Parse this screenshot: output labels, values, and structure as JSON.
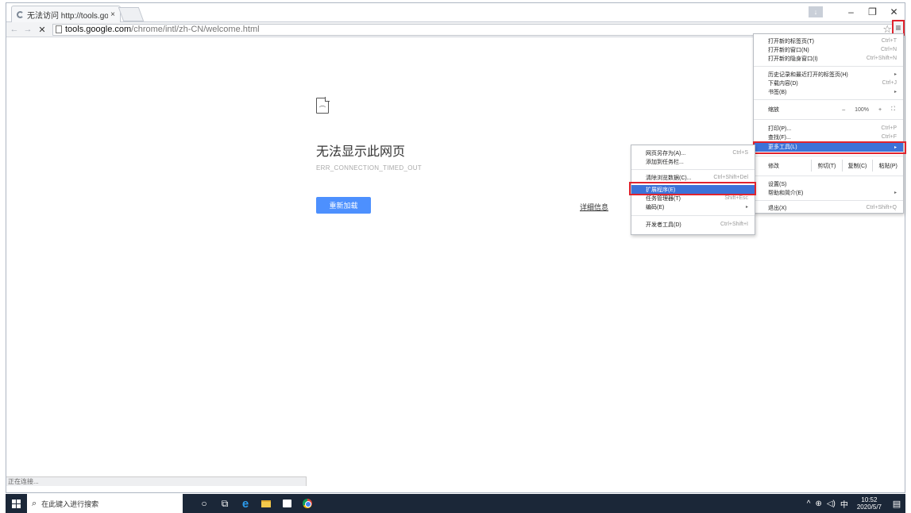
{
  "window": {
    "tab_title": "无法访问 http://tools.go",
    "tab_close": "×",
    "download_glyph": "↓",
    "minimize": "–",
    "restore": "❐",
    "close": "✕"
  },
  "toolbar": {
    "back": "←",
    "forward": "→",
    "stop": "✕",
    "url_host": "tools.google.com",
    "url_path": "/chrome/intl/zh-CN/welcome.html",
    "star": "☆",
    "menu": "≡"
  },
  "error_page": {
    "title": "无法显示此网页",
    "code": "ERR_CONNECTION_TIMED_OUT",
    "reload_label": "重新加载",
    "details_label": "详细信息"
  },
  "status_text": "正在连接...",
  "main_menu": {
    "items": [
      {
        "label": "打开新的标签页(T)",
        "shortcut": "Ctrl+T"
      },
      {
        "label": "打开新的窗口(N)",
        "shortcut": "Ctrl+N"
      },
      {
        "label": "打开新的隐身窗口(I)",
        "shortcut": "Ctrl+Shift+N"
      },
      {
        "label": "历史记录和最近打开的标签页(H)",
        "shortcut": "▸"
      },
      {
        "label": "下载内容(D)",
        "shortcut": "Ctrl+J"
      },
      {
        "label": "书签(B)",
        "shortcut": "▸"
      },
      {
        "label": "打印(P)...",
        "shortcut": "Ctrl+P"
      },
      {
        "label": "查找(F)...",
        "shortcut": "Ctrl+F"
      },
      {
        "label": "更多工具(L)",
        "shortcut": "▸"
      },
      {
        "label": "设置(S)",
        "shortcut": ""
      },
      {
        "label": "帮助和简介(E)",
        "shortcut": "▸"
      },
      {
        "label": "退出(X)",
        "shortcut": "Ctrl+Shift+Q"
      }
    ],
    "zoom": {
      "label": "缩放",
      "minus": "–",
      "value": "100%",
      "plus": "+",
      "fullscreen": "⛶"
    },
    "edit": {
      "label": "修改",
      "cut": "剪切(T)",
      "copy": "复制(C)",
      "paste": "粘贴(P)"
    }
  },
  "sub_menu": {
    "items": [
      {
        "label": "网页另存为(A)...",
        "shortcut": "Ctrl+S"
      },
      {
        "label": "添加到任务栏...",
        "shortcut": ""
      },
      {
        "label": "清除浏览数据(C)...",
        "shortcut": "Ctrl+Shift+Del"
      },
      {
        "label": "扩展程序(E)",
        "shortcut": ""
      },
      {
        "label": "任务管理器(T)",
        "shortcut": "Shift+Esc"
      },
      {
        "label": "编码(E)",
        "shortcut": "▸"
      },
      {
        "label": "开发者工具(D)",
        "shortcut": "Ctrl+Shift+I"
      }
    ]
  },
  "taskbar": {
    "search_placeholder": "在此键入进行搜索",
    "search_glyph": "⌕",
    "cortana_glyph": "○",
    "taskview_glyph": "⧉",
    "edge_glyph": "e",
    "tray_chevron": "^",
    "network_glyph": "⊕",
    "volume_glyph": "◁)",
    "ime": "中",
    "time": "10:52",
    "date": "2020/5/7",
    "notification_glyph": "▤"
  },
  "colors": {
    "highlight": "#3c72d8",
    "annotation_red": "#e0232d",
    "reload_button": "#4d90fe",
    "taskbar": "#1b2738"
  }
}
